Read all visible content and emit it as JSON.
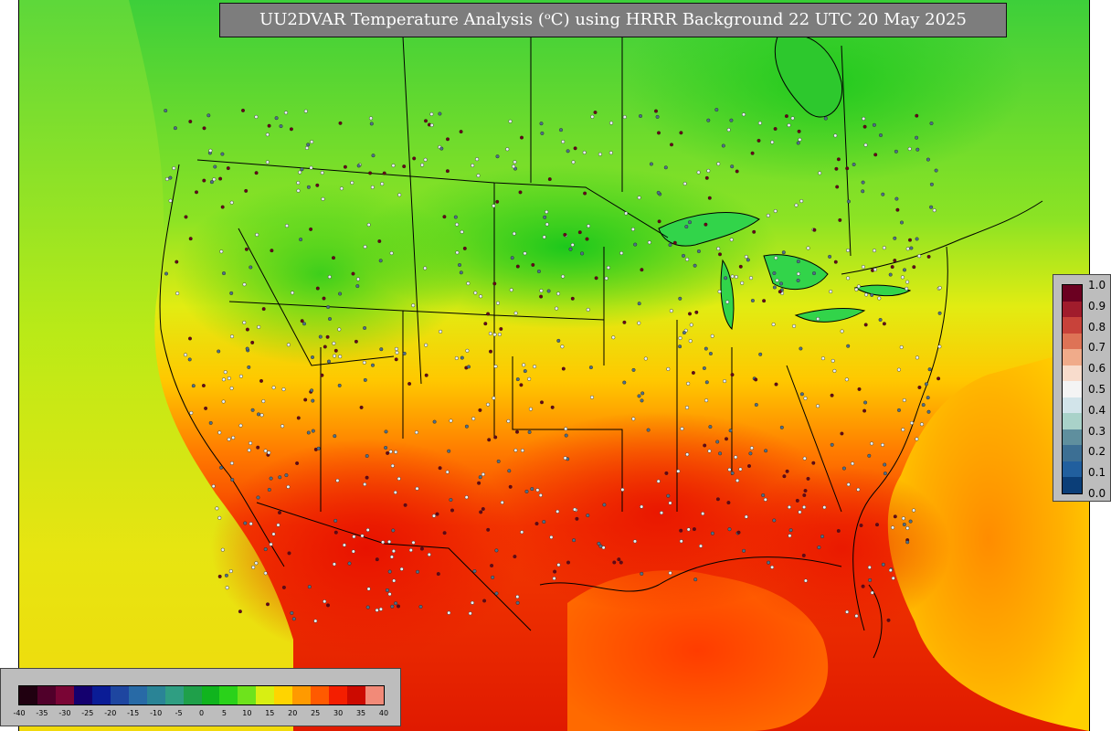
{
  "title": "UU2DVAR Temperature Analysis (ᵒC) using HRRR Background 22 UTC 20 May 2025",
  "temperature_colorbar": {
    "tick_labels": [
      "-40",
      "-35",
      "-30",
      "-25",
      "-20",
      "-15",
      "-10",
      "-5",
      "0",
      "5",
      "10",
      "15",
      "20",
      "25",
      "30",
      "35",
      "40"
    ],
    "colors": [
      "#200010",
      "#50002a",
      "#7a0535",
      "#14006e",
      "#0a1c96",
      "#1e46a0",
      "#286aa6",
      "#2a8496",
      "#2f9e82",
      "#1fa04a",
      "#10b41e",
      "#2ad21a",
      "#6ee31c",
      "#d8ef12",
      "#ffd400",
      "#ff9a00",
      "#ff5a00",
      "#f41e00",
      "#cc0a00",
      "#f28a78"
    ]
  },
  "ratio_colorbar": {
    "tick_labels": [
      "1.0",
      "0.9",
      "0.8",
      "0.7",
      "0.6",
      "0.5",
      "0.4",
      "0.3",
      "0.2",
      "0.1",
      "0.0"
    ],
    "colors": [
      "#6b0021",
      "#a01c2c",
      "#c8423a",
      "#de7356",
      "#f0ab8a",
      "#f8dccc",
      "#f4f4f4",
      "#d2e4ea",
      "#a9d2c9",
      "#5f8f9e",
      "#3c6f94",
      "#215f9e",
      "#0b3e78"
    ]
  },
  "map_colors": {
    "ocean_north": "#46d24a",
    "cold_green": "#2fcf2a",
    "mild_green": "#7be02c",
    "yellow": "#e6ee14",
    "orange": "#ffb600",
    "red": "#f23200",
    "deep_red": "#d81400",
    "border": "#000000",
    "station_cool": "#e8f0f4",
    "station_warm": "#6a0014",
    "station_mid": "#4d6f8a"
  }
}
